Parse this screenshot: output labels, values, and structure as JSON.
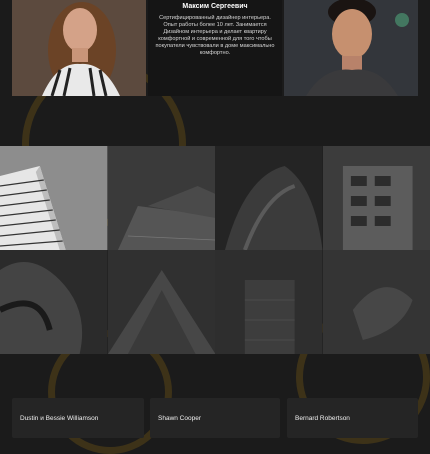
{
  "team": {
    "featured": {
      "name": "Максим Сергеевич",
      "bio": "Сертифицированный дизайнер интерьера. Опыт работы более 10 лет. Занимается Дизайном интерьера и делает квартиру комфортной и современной для того чтобы покупатели чувствовали в доме максимально комфортно."
    }
  },
  "reviews": [
    {
      "name": "Dustin и Bessie Williamson"
    },
    {
      "name": "Shawn Cooper"
    },
    {
      "name": "Bernard Robertson"
    }
  ],
  "gallery": {
    "tiles": [
      "building-photo",
      "building-photo",
      "building-photo",
      "building-photo",
      "building-photo",
      "building-photo",
      "building-photo",
      "building-photo"
    ]
  },
  "colors": {
    "background": "#1b1b1b",
    "accent_ring": "#5a4516",
    "card": "#252525"
  }
}
